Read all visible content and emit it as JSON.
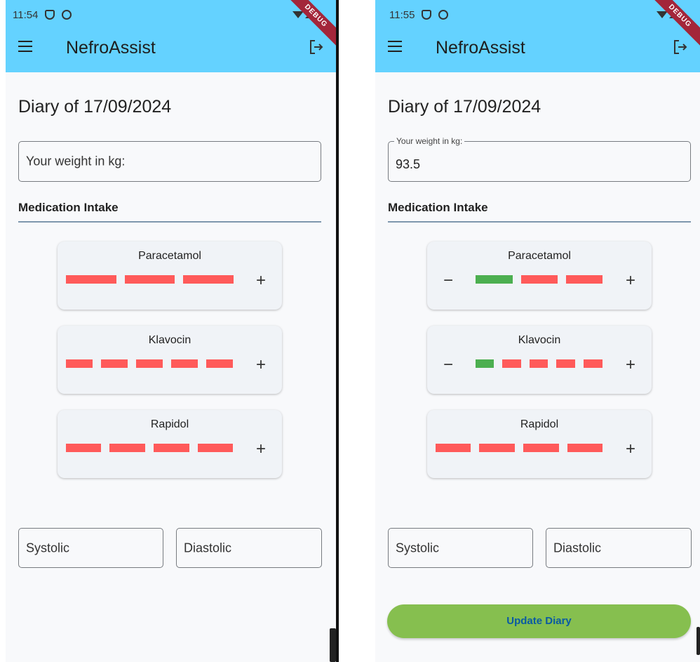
{
  "screens": [
    {
      "status_time": "11:54",
      "debug_banner": "DEBUG",
      "app_title": "NefroAssist",
      "diary_title": "Diary of 17/09/2024",
      "weight": {
        "label": "Your weight in kg:",
        "value": ""
      },
      "section_title": "Medication Intake",
      "medications": [
        {
          "name": "Paracetamol",
          "doses_taken": 0,
          "doses_total": 3
        },
        {
          "name": "Klavocin",
          "doses_taken": 0,
          "doses_total": 5
        },
        {
          "name": "Rapidol",
          "doses_taken": 0,
          "doses_total": 4
        }
      ],
      "minus_symbol": "−",
      "plus_symbol": "+",
      "systolic_placeholder": "Systolic",
      "diastolic_placeholder": "Diastolic"
    },
    {
      "status_time": "11:55",
      "debug_banner": "DEBUG",
      "app_title": "NefroAssist",
      "diary_title": "Diary of 17/09/2024",
      "weight": {
        "label": "Your weight in kg:",
        "value": "93.5"
      },
      "section_title": "Medication Intake",
      "medications": [
        {
          "name": "Paracetamol",
          "doses_taken": 1,
          "doses_total": 3
        },
        {
          "name": "Klavocin",
          "doses_taken": 1,
          "doses_total": 5
        },
        {
          "name": "Rapidol",
          "doses_taken": 0,
          "doses_total": 4
        }
      ],
      "minus_symbol": "−",
      "plus_symbol": "+",
      "systolic_placeholder": "Systolic",
      "diastolic_placeholder": "Diastolic",
      "update_button_label": "Update Diary"
    }
  ],
  "colors": {
    "appbar": "#64d2ff",
    "dose_pending": "#ff5a5a",
    "dose_taken": "#4caf50",
    "update_button": "#86bf4f",
    "update_button_text": "#0a5aa3"
  },
  "icons": [
    "menu-icon",
    "logout-icon",
    "shield-icon",
    "sync-icon",
    "wifi-icon",
    "signal-icon"
  ]
}
